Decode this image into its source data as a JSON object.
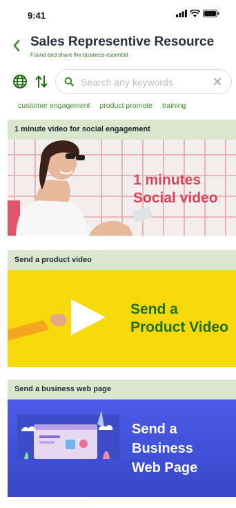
{
  "status": {
    "time": "9:41"
  },
  "header": {
    "title": "Sales Representive Resource",
    "subtitle": "Found and share the business essential"
  },
  "search": {
    "placeholder": "Search any keywords",
    "value": ""
  },
  "tags": [
    "customer engagement",
    "product promote",
    "training"
  ],
  "sections": [
    {
      "header": "1 minute video for social engagement",
      "banner_line1": "1 minutes",
      "banner_line2": "Social video"
    },
    {
      "header": "Send a product video",
      "banner_line1": "Send a",
      "banner_line2": "Product Video"
    },
    {
      "header": "Send a business web page",
      "banner_line1": "Send a",
      "banner_line2": "Business",
      "banner_line3": "Web Page"
    }
  ],
  "colors": {
    "accent_green": "#3b8a2a",
    "section_header_bg": "#dbe7cc",
    "social_text": "#d8465b",
    "product_bg": "#f6d90a",
    "product_text": "#1f6e12",
    "webpage_bg": "#4b5ce8"
  },
  "icons": [
    "back-chevron-icon",
    "globe-icon",
    "sort-icon",
    "search-icon",
    "clear-icon",
    "play-icon"
  ]
}
